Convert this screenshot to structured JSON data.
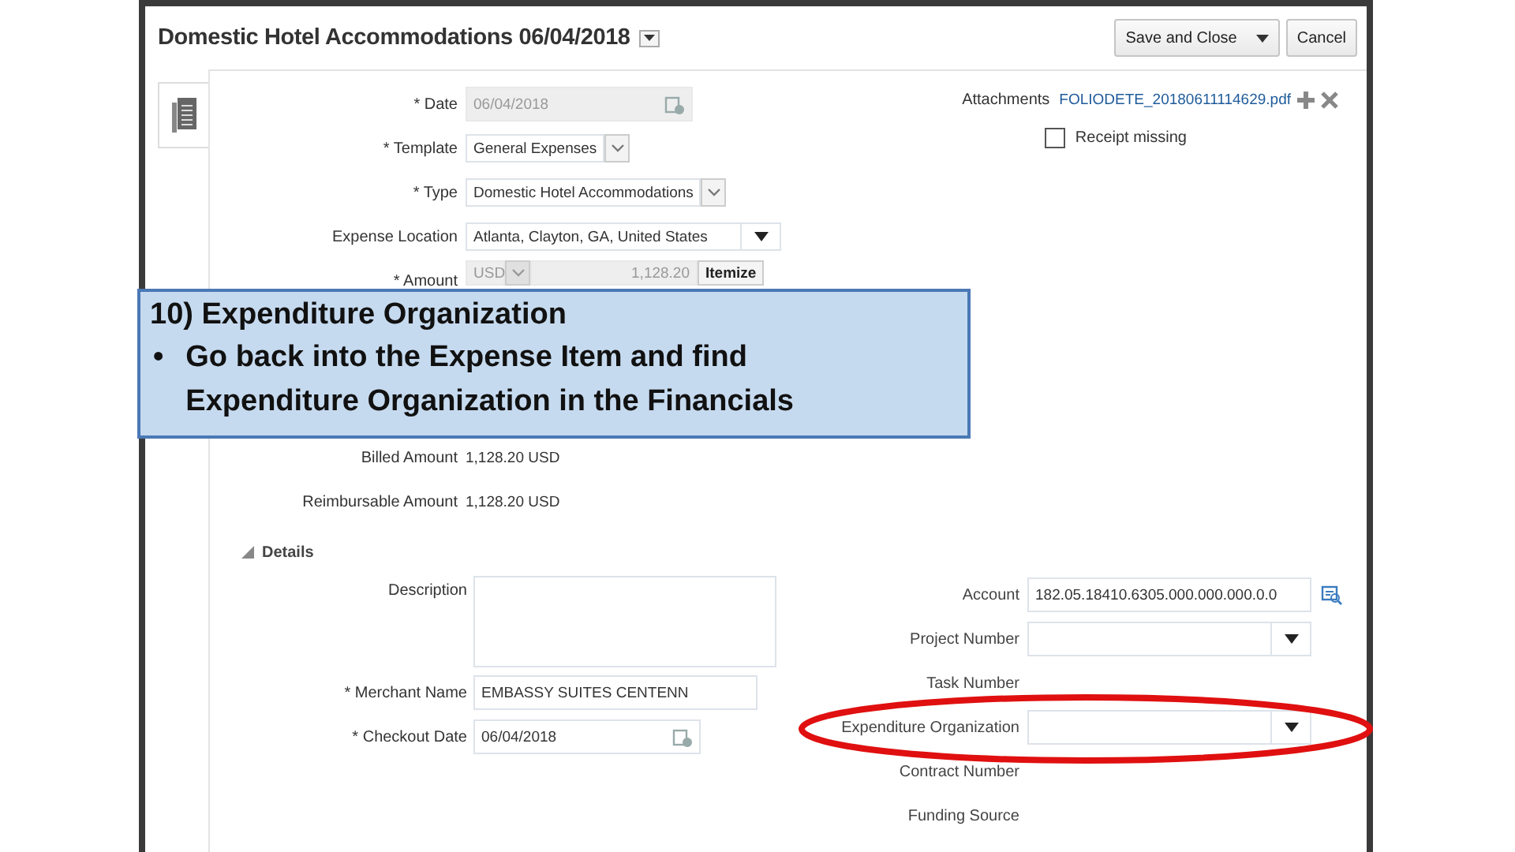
{
  "header": {
    "title": "Domestic Hotel Accommodations 06/04/2018",
    "buttons": [
      {
        "label": "Save and Close",
        "kind": "menu"
      },
      {
        "label": "Cancel",
        "kind": "plain"
      }
    ]
  },
  "form": {
    "fields": [
      {
        "label": "* Date",
        "kind": "date",
        "value": "06/04/2018",
        "disabled": true
      },
      {
        "label": "* Template",
        "kind": "choice",
        "value": "General Expenses"
      },
      {
        "label": "* Type",
        "kind": "choice",
        "value": "Domestic Hotel Accommodations"
      },
      {
        "label": "Expense Location",
        "kind": "list",
        "value": "Atlanta, Clayton, GA, United States"
      },
      {
        "label": "* Amount",
        "kind": "amount",
        "currency": "USD",
        "value": "1,128.20",
        "button": "Itemize",
        "disabled": true
      }
    ],
    "totals": [
      {
        "label": "Billed Amount",
        "kind": "readonly",
        "value": "1,128.20 USD"
      },
      {
        "label": "Reimbursable Amount",
        "kind": "readonly",
        "value": "1,128.20 USD"
      }
    ],
    "attachments": {
      "label": "Attachments",
      "file": "FOLIODETE_20180611114629.pdf"
    },
    "receipt_missing": {
      "label": "Receipt missing",
      "checked": false
    }
  },
  "details": {
    "label": "Details",
    "expanded": true,
    "left": [
      {
        "label": "Description",
        "kind": "textarea"
      },
      {
        "label": "* Merchant Name",
        "kind": "text",
        "value": "EMBASSY SUITES CENTENN"
      },
      {
        "label": "* Checkout Date",
        "kind": "date",
        "value": "06/04/2018",
        "disabled": false
      }
    ],
    "right": [
      {
        "label": "Account",
        "kind": "account",
        "value": "182.05.18410.6305.000.000.000.0.0"
      },
      {
        "label": "Project Number",
        "kind": "list"
      },
      {
        "label": "Task Number",
        "kind": "none"
      },
      {
        "label": "Expenditure Organization",
        "kind": "list"
      },
      {
        "label": "Contract Number",
        "kind": "none"
      },
      {
        "label": "Funding Source",
        "kind": "none"
      }
    ]
  },
  "callout": {
    "title": "10) Expenditure Organization",
    "bullet": "•",
    "text": "Go back into the Expense Item and find Expenditure Organization in the Financials"
  }
}
